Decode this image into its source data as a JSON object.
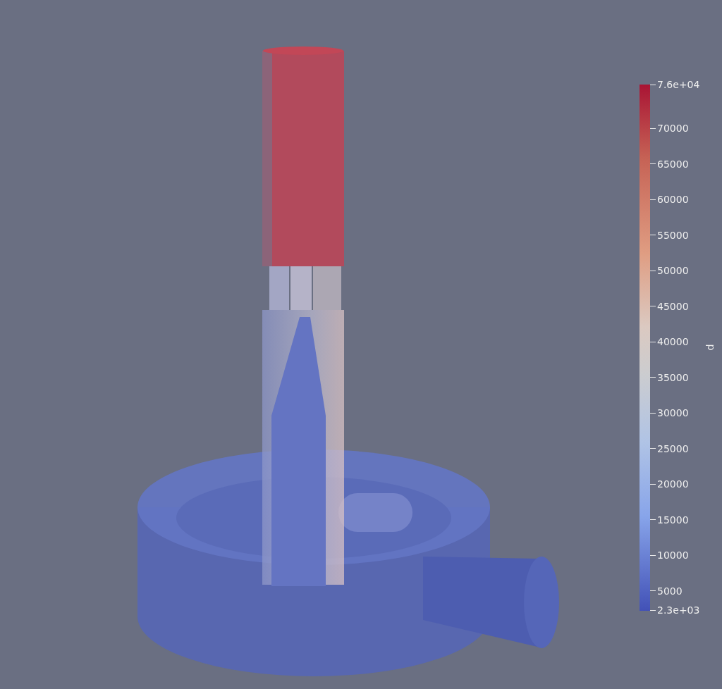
{
  "render_view": {
    "color_legend": {
      "title": "p",
      "max_label": "7.6e+04",
      "min_label": "2.3e+03",
      "tick_labels": [
        "70000",
        "65000",
        "60000",
        "55000",
        "50000",
        "45000",
        "40000",
        "35000",
        "30000",
        "25000",
        "20000",
        "15000",
        "10000",
        "5000"
      ]
    }
  }
}
